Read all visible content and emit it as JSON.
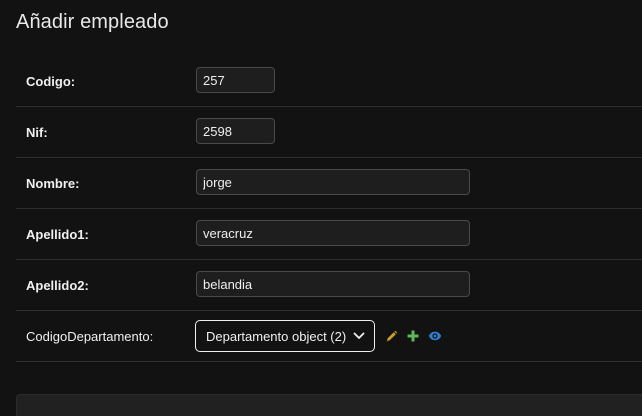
{
  "page": {
    "title": "Añadir empleado"
  },
  "form": {
    "fields": [
      {
        "label": "Codigo:",
        "value": "257",
        "required": true
      },
      {
        "label": "Nif:",
        "value": "2598",
        "required": true
      },
      {
        "label": "Nombre:",
        "value": "jorge",
        "required": true
      },
      {
        "label": "Apellido1:",
        "value": "veracruz",
        "required": true
      },
      {
        "label": "Apellido2:",
        "value": "belandia",
        "required": true
      }
    ],
    "departamento": {
      "label": "CodigoDepartamento:",
      "selected": "Departamento object (2)",
      "required": false
    }
  },
  "icons": {
    "edit": "pencil-icon",
    "add": "plus-icon",
    "view": "eye-icon",
    "dropdown": "chevron-down-icon"
  },
  "colors": {
    "background": "#121212",
    "edit_icon": "#c9a227",
    "add_icon": "#5cb85c",
    "view_icon": "#2f7dd1"
  }
}
